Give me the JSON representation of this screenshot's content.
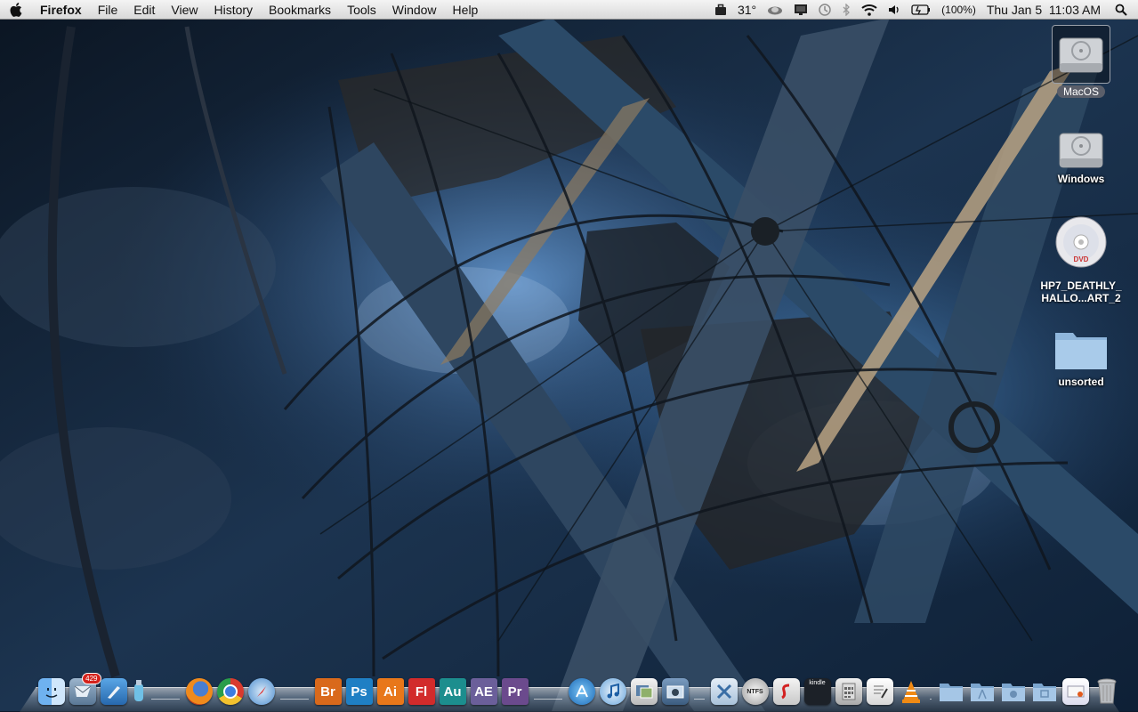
{
  "menubar": {
    "app_name": "Firefox",
    "menus": [
      "File",
      "Edit",
      "View",
      "History",
      "Bookmarks",
      "Tools",
      "Window",
      "Help"
    ],
    "status": {
      "temperature": "31°",
      "battery": "(100%)",
      "datetime": "Thu Jan 5  11:03 AM"
    }
  },
  "desktop": {
    "icons": [
      {
        "label": "MacOS",
        "type": "hard-drive",
        "selected": true
      },
      {
        "label": "Windows",
        "type": "hard-drive"
      },
      {
        "label_line1": "HP7_DEATHLY_",
        "label_line2": "HALLO...ART_2",
        "type": "dvd"
      },
      {
        "label": "unsorted",
        "type": "folder"
      }
    ]
  },
  "dock": {
    "mail_badge": "429",
    "adobe": {
      "bridge": "Br",
      "photoshop": "Ps",
      "illustrator": "Ai",
      "flash": "Fl",
      "audition": "Au",
      "after_effects": "AE",
      "premiere": "Pr"
    },
    "kindle": "kindle",
    "ntfs": "NTFS",
    "colors": {
      "bridge": "#d9691b",
      "photoshop": "#1f7fc4",
      "illustrator": "#e8771a",
      "flash": "#d22b2b",
      "audition": "#1c8e8e",
      "after_effects": "#6b5f9a",
      "premiere": "#6b4a8d"
    }
  }
}
